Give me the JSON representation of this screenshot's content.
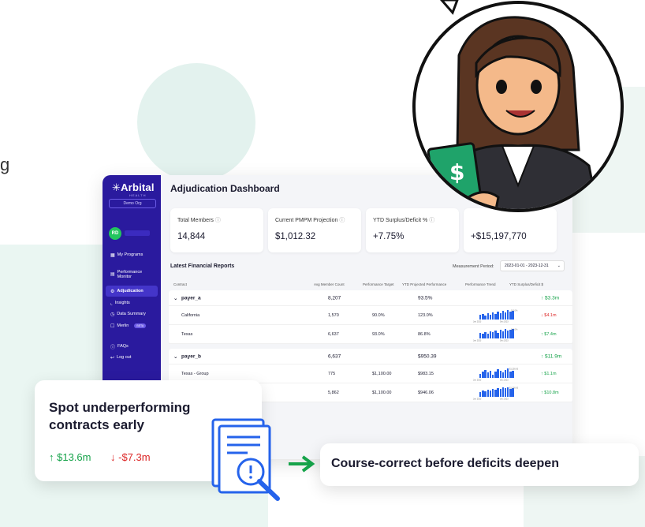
{
  "app": {
    "name": "Arbital",
    "sub": "HEALTH",
    "org": "Demo Org"
  },
  "user": {
    "initials": "RD"
  },
  "sidebar": {
    "items": [
      {
        "label": "My Programs",
        "icon": "grid-icon"
      },
      {
        "label": "Performance Monitor",
        "icon": "monitor-icon"
      },
      {
        "label": "Adjudication",
        "icon": "gavel-icon",
        "active": true
      },
      {
        "label": "Insights",
        "icon": "chart-icon"
      },
      {
        "label": "Data Summary",
        "icon": "clock-icon"
      },
      {
        "label": "Merlin",
        "icon": "chat-icon",
        "badge": "BETA"
      },
      {
        "label": "FAQs",
        "icon": "help-icon"
      },
      {
        "label": "Log out",
        "icon": "logout-icon"
      }
    ]
  },
  "dashboard": {
    "title": "Adjudication Dashboard",
    "cards": [
      {
        "label": "Total Members",
        "value": "14,844"
      },
      {
        "label": "Current PMPM Projection",
        "value": "$1,012.32"
      },
      {
        "label": "YTD Surplus/Deficit %",
        "value": "+7.75%"
      },
      {
        "label": "",
        "value": "+$15,197,770"
      }
    ],
    "section_title": "Latest Financial Reports",
    "period_label": "Measurement Period:",
    "period_value": "2023-01-01 - 2023-12-31",
    "columns": [
      "Contract",
      "Avg Member Count",
      "Performance Target",
      "YTD Projected Performance",
      "Performance Trend",
      "YTD Surplus/Deficit $"
    ],
    "groups": [
      {
        "name": "payer_a",
        "members": "8,207",
        "target": "",
        "ytd": "93.5%",
        "surplus": "↑ $3.3m",
        "rows": [
          {
            "name": "California",
            "members": "1,570",
            "target": "90.0%",
            "ytd": "123.0%",
            "surplus": "↓ $4.1m",
            "trend": [
              6,
              8,
              5,
              9,
              7,
              10,
              8,
              11,
              9,
              12,
              10,
              13,
              11,
              12
            ],
            "sign": "neg",
            "cap_start": "Jan 2023",
            "cap_end": "Dec 2023",
            "cap_top": "110.0%"
          },
          {
            "name": "Texas",
            "members": "6,637",
            "target": "93.0%",
            "ytd": "86.8%",
            "surplus": "↑ $7.4m",
            "trend": [
              8,
              6,
              9,
              7,
              10,
              9,
              11,
              8,
              12,
              10,
              13,
              11,
              12,
              13
            ],
            "sign": "pos",
            "cap_start": "Jan 2023",
            "cap_end": "Dec 2023",
            "cap_top": "110.0%"
          }
        ]
      },
      {
        "name": "payer_b",
        "members": "6,637",
        "target": "",
        "ytd": "$950.39",
        "surplus": "↑ $11.9m",
        "rows": [
          {
            "name": "Texas - Group",
            "members": "775",
            "target": "$1,100.00",
            "ytd": "$983.15",
            "surplus": "↑ $1.1m",
            "trend": [
              5,
              7,
              9,
              6,
              8,
              4,
              7,
              10,
              8,
              6,
              9,
              11,
              7,
              8
            ],
            "sign": "pos",
            "cap_start": "Jan 2023",
            "cap_end": "Dec 2023",
            "cap_top": "$1,200.00"
          },
          {
            "name": "",
            "members": "5,862",
            "target": "$1,100.00",
            "ytd": "$946.06",
            "surplus": "↑ $10.8m",
            "trend": [
              6,
              8,
              7,
              9,
              8,
              10,
              9,
              11,
              10,
              12,
              11,
              12,
              10,
              11
            ],
            "sign": "pos",
            "cap_start": "Jan 2023",
            "cap_end": "Dec 2023",
            "cap_top": "$1,200.00"
          }
        ]
      }
    ]
  },
  "callout": {
    "title": "Spot underperforming contracts early",
    "positive": "↑ $13.6m",
    "negative": "↓ -$7.3m"
  },
  "course": {
    "text": "Course-correct before deficits deepen"
  },
  "edge_letter": "g",
  "colors": {
    "sidebar": "#2a1a9e",
    "positive": "#16a34a",
    "negative": "#dc2626",
    "accent": "#22c55e"
  }
}
